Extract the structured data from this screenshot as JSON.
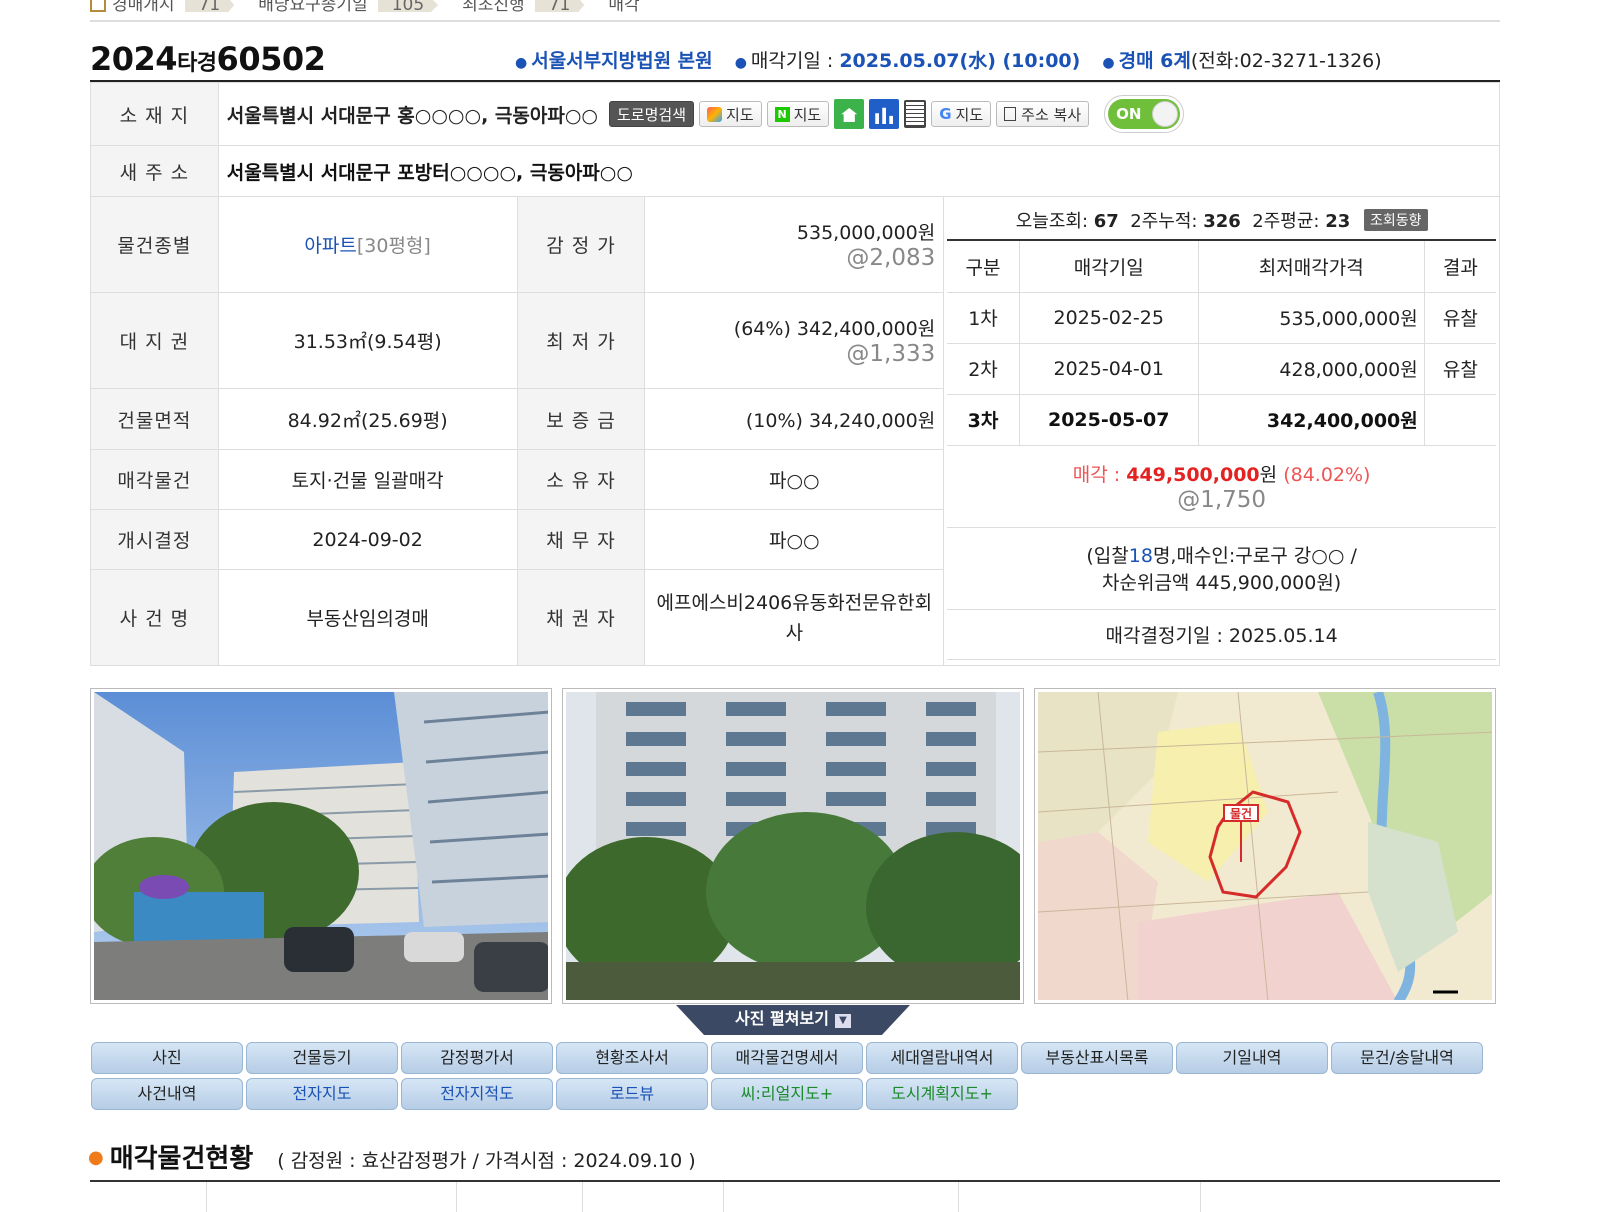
{
  "timeline": {
    "items": [
      {
        "label": "경매개시",
        "badge": "71"
      },
      {
        "label": "배당요구종기일",
        "badge": "105"
      },
      {
        "label": "최초진행",
        "badge": "71"
      },
      {
        "label": "매각",
        "badge": ""
      }
    ]
  },
  "case": {
    "number_year": "2024",
    "number_type": "타경",
    "number_no": "60502",
    "court": "서울서부지방법원 본원",
    "sale_date_label": "매각기일 : ",
    "sale_date": "2025.05.07(水) (10:00)",
    "division": "경매 6계",
    "phone": "(전화:02-3271-1326)"
  },
  "location": {
    "label": "소 재 지",
    "address": "서울특별시 서대문구 홍○○○○, 극동아파○○",
    "buttons": [
      "도로명검색",
      "지도",
      "지도",
      "지도",
      "주소 복사"
    ],
    "toggle": "ON"
  },
  "new_address": {
    "label": "새 주 소",
    "address": "서울특별시 서대문구 포방터○○○○, 극동아파○○"
  },
  "details": {
    "type_label": "물건종별",
    "type_value": "아파트",
    "type_extra": "[30평형]",
    "appraisal_label": "감 정 가",
    "appraisal_value": "535,000,000원",
    "appraisal_per": "@2,083",
    "land_label": "대 지 권",
    "land_value": "31.53㎡(9.54평)",
    "min_label": "최 저 가",
    "min_value": "(64%) 342,400,000원",
    "min_per": "@1,333",
    "building_label": "건물면적",
    "building_value": "84.92㎡(25.69평)",
    "deposit_label": "보 증 금",
    "deposit_value": "(10%) 34,240,000원",
    "sale_item_label": "매각물건",
    "sale_item_value": "토지·건물 일괄매각",
    "owner_label": "소 유 자",
    "owner_value": "파○○",
    "start_label": "개시결정",
    "start_value": "2024-09-02",
    "debtor_label": "채 무 자",
    "debtor_value": "파○○",
    "case_label": "사 건 명",
    "case_value": "부동산임의경매",
    "creditor_label": "채 권 자",
    "creditor_value": "에프에스비2406유동화전문유한회사"
  },
  "views": {
    "today_label": "오늘조회:",
    "today": "67",
    "two_week_label": "2주누적:",
    "two_week": "326",
    "avg_label": "2주평균:",
    "avg": "23",
    "trend_button": "조회동향"
  },
  "rounds": {
    "headers": [
      "구분",
      "매각기일",
      "최저매각가격",
      "결과"
    ],
    "rows": [
      [
        "1차",
        "2025-02-25",
        "535,000,000원",
        "유찰"
      ],
      [
        "2차",
        "2025-04-01",
        "428,000,000원",
        "유찰"
      ],
      [
        "3차",
        "2025-05-07",
        "342,400,000원",
        ""
      ]
    ]
  },
  "sale_result": {
    "label": "매각 : ",
    "amount": "449,500,000",
    "unit": "원",
    "percent": "(84.02%)",
    "per": "@1,750",
    "bidders_prefix": "(입찰",
    "bidders_count": "18",
    "bidders_suffix": "명,매수인:구로구 강○○ /",
    "second_bid": "차순위금액 445,900,000원)",
    "decision_date": "매각결정기일 : 2025.05.14"
  },
  "photos": {
    "expand_button": "사진 펼쳐보기",
    "map_marker": "물건"
  },
  "tabs": {
    "row1": [
      "사진",
      "건물등기",
      "감정평가서",
      "현황조사서",
      "매각물건명세서",
      "세대열람내역서",
      "부동산표시목록",
      "기일내역",
      "문건/송달내역"
    ],
    "row2": [
      "사건내역",
      "전자지도",
      "전자지적도",
      "로드뷰",
      "씨:리얼지도+",
      "도시계획지도+"
    ]
  },
  "section": {
    "title": "매각물건현황",
    "subtitle": "( 감정원 : 효산감정평가 / 가격시점 : 2024.09.10 )"
  },
  "colors": {
    "accent_blue": "#1a52b5",
    "sale_red": "#e52222",
    "toggle_green": "#6fbf3a",
    "tab_bg": "#c6d9ee"
  }
}
